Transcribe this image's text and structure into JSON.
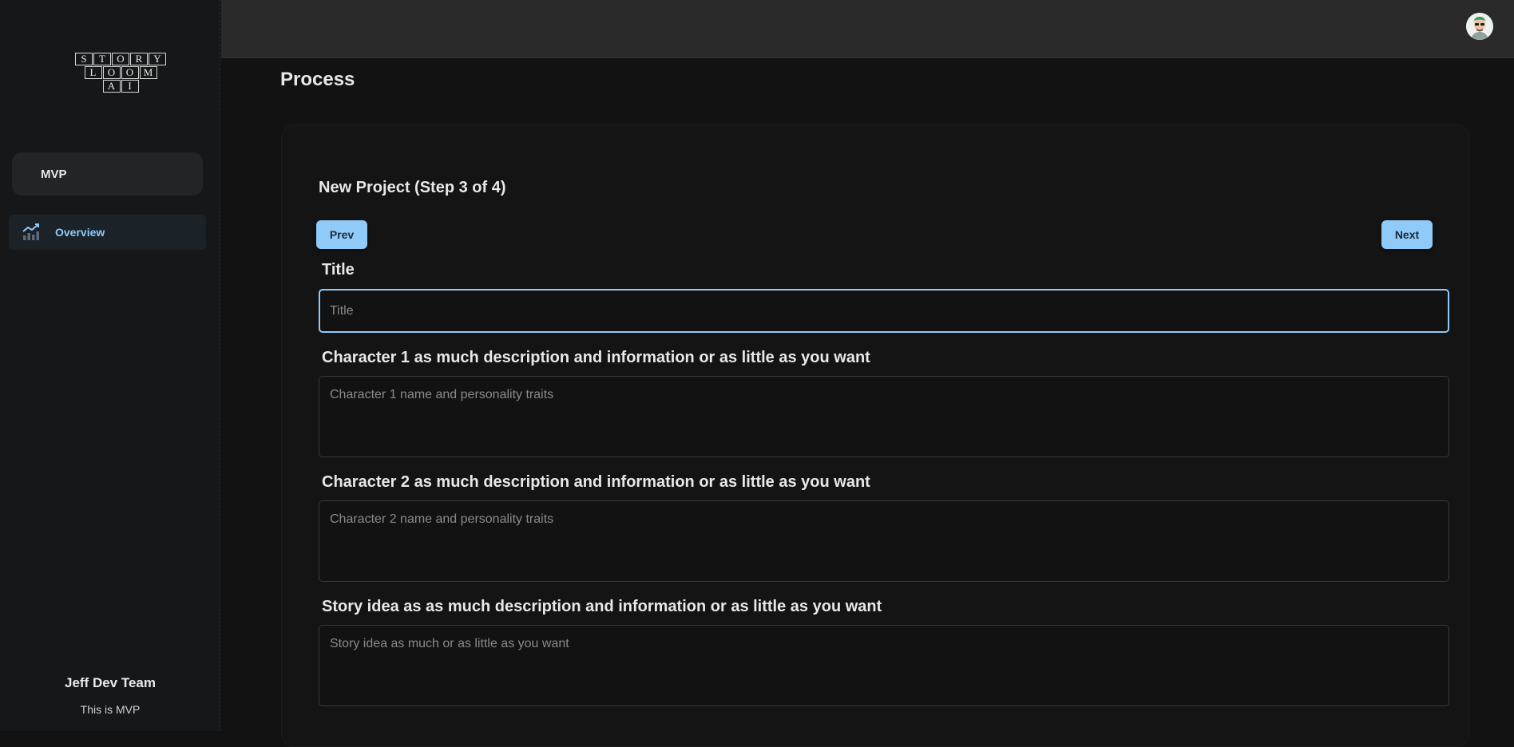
{
  "logo": {
    "rows": [
      [
        "S",
        "T",
        "O",
        "R",
        "Y"
      ],
      [
        "L",
        "O",
        "O",
        "M"
      ],
      [
        "A",
        "I"
      ]
    ]
  },
  "sidebar": {
    "project": "MVP",
    "nav": [
      {
        "label": "Overview",
        "icon": "chart-trend-icon",
        "active": true
      }
    ],
    "footer": {
      "name": "Jeff Dev Team",
      "subtitle": "This is MVP"
    }
  },
  "header": {
    "avatar": "user-avatar"
  },
  "main": {
    "page_title": "Process",
    "step_title": "New Project (Step 3 of 4)",
    "prev_label": "Prev",
    "next_label": "Next",
    "fields": {
      "title": {
        "label": "Title",
        "placeholder": "Title",
        "value": ""
      },
      "character1": {
        "label": "Character 1 as much description and information or as little as you want",
        "placeholder": "Character 1 name and personality traits",
        "value": ""
      },
      "character2": {
        "label": "Character 2 as much description and information or as little as you want",
        "placeholder": "Character 2 name and personality traits",
        "value": ""
      },
      "story": {
        "label": "Story idea as as much description and information or as little as you want",
        "placeholder": "Story idea as much or as little as you want",
        "value": ""
      }
    }
  },
  "colors": {
    "accent": "#90caf9",
    "background": "#121212",
    "sidebar": "#161718",
    "topbar": "#2a2a2a"
  }
}
